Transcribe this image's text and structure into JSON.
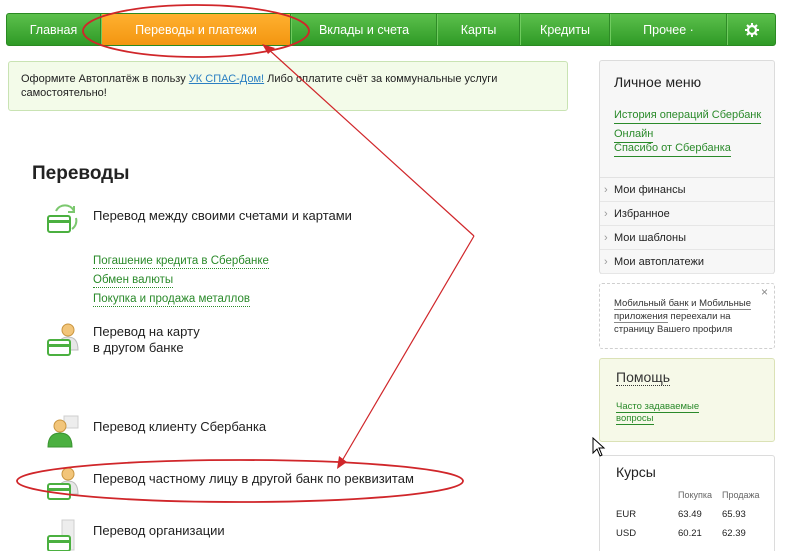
{
  "nav": {
    "items": [
      {
        "label": "Главная"
      },
      {
        "label": "Переводы и платежи"
      },
      {
        "label": "Вклады и счета"
      },
      {
        "label": "Карты"
      },
      {
        "label": "Кредиты"
      },
      {
        "label": "Прочее ·"
      }
    ],
    "gear_icon": "gear-icon"
  },
  "banner": {
    "text_before": "Оформите Автоплатёж в пользу ",
    "link": "УК СПАС-Дом!",
    "text_after": " Либо оплатите счёт за коммунальные услуги самостоятельно!"
  },
  "main": {
    "title": "Переводы",
    "transfers": [
      {
        "label": "Перевод между своими счетами и картами",
        "icon": "cards-exchange-icon"
      },
      {
        "label": "Перевод на карту в другом банке",
        "line1": "Перевод на карту",
        "line2": "в другом банке",
        "icon": "person-card-icon"
      },
      {
        "label": "Перевод клиенту Сбербанка",
        "icon": "person-client-icon"
      },
      {
        "label": "Перевод частному лицу в другой банк по реквизитам",
        "icon": "person-card-icon"
      },
      {
        "label": "Перевод организации",
        "icon": "building-card-icon"
      }
    ],
    "sublinks": [
      "Погашение кредита в Сбербанке",
      "Обмен валюты",
      "Покупка и продажа металлов"
    ]
  },
  "sidebar": {
    "menu_title": "Личное меню",
    "links": [
      "История операций Сбербанк Онлайн",
      "Спасибо от Сбербанка"
    ],
    "links_lines": [
      [
        "История операций Сбербанк",
        "Онлайн"
      ],
      [
        "Спасибо от Сбербанка"
      ]
    ],
    "items": [
      "Мои финансы",
      "Избранное",
      "Мои шаблоны",
      "Мои автоплатежи"
    ],
    "mobile": {
      "part1": "Мобильный банк",
      "and": " и ",
      "part2": "Мобильные приложения",
      "rest": " переехали на страницу Вашего профиля",
      "close": "×"
    },
    "help": {
      "title": "Помощь",
      "link": "Часто задаваемые вопросы",
      "link_lines": [
        "Часто задаваемые",
        "вопросы"
      ]
    },
    "rates": {
      "title": "Курсы",
      "headers": [
        "Покупка",
        "Продажа"
      ],
      "rows": [
        {
          "currency": "EUR",
          "buy": "63.49",
          "sell": "65.93"
        },
        {
          "currency": "USD",
          "buy": "60.21",
          "sell": "62.39"
        }
      ]
    }
  },
  "colors": {
    "nav_green": "#3fae31",
    "nav_active": "#f7a11f",
    "annotation_red": "#d0262a",
    "link_green": "#2a8a2a"
  }
}
